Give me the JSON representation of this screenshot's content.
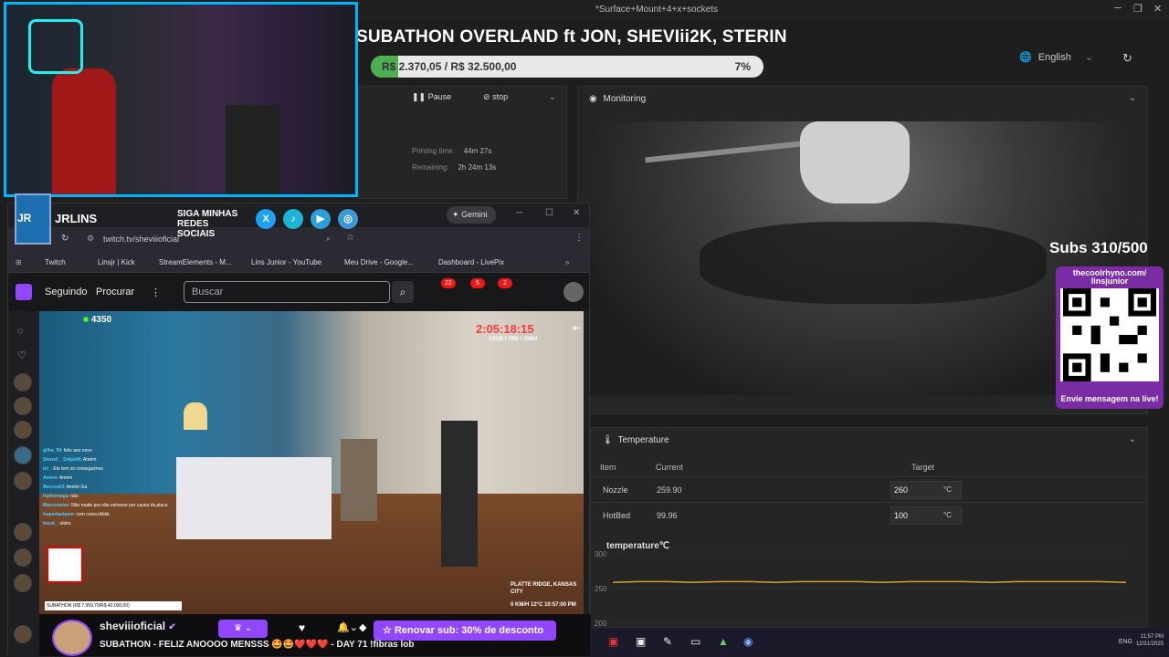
{
  "window": {
    "title": "*Surface+Mount+4+x+sockets"
  },
  "overlay": {
    "title": "SUBATHON OVERLAND ft JON, SHEVIii2K, STERIN",
    "goal_text": "R$ 2.370,05 / R$ 32.500,00",
    "goal_percent_label": "7%",
    "goal_progress": 0.07,
    "subs_counter": "Subs 310/500",
    "qr_url": "thecoolrhyno.com/ linsjunior",
    "qr_cta": "Envie mensagem na live!",
    "social_channel": "JRLINS",
    "social_siga": "SIGA MINHAS REDES SOCIAIS"
  },
  "printer": {
    "language": "English",
    "controls": {
      "pause_label": "Pause",
      "stop_label": "stop",
      "printing_time_label": "Printing time:",
      "printing_time_value": "44m 27s",
      "remaining_label": "Remaining:",
      "remaining_value": "2h 24m 13s"
    },
    "monitoring": {
      "title": "Monitoring"
    },
    "temperature": {
      "title": "Temperature",
      "col_item": "Item",
      "col_current": "Current",
      "col_target": "Target",
      "rows": [
        {
          "item": "Nozzle",
          "current": "259.90",
          "target": "260",
          "unit": "°C"
        },
        {
          "item": "HotBed",
          "current": "99.96",
          "target": "100",
          "unit": "°C"
        }
      ],
      "chart_title": "temperature℃"
    }
  },
  "chart_data": {
    "type": "line",
    "title": "temperature℃",
    "ylim": [
      200,
      300
    ],
    "yticks": [
      "300",
      "250",
      "200"
    ],
    "series": [
      {
        "color": "#d4a52a",
        "values": [
          259,
          260,
          260,
          259,
          260,
          260,
          259,
          260,
          260,
          260,
          259,
          260,
          260,
          260,
          259,
          260,
          260,
          260,
          260,
          259
        ]
      }
    ]
  },
  "browser": {
    "gemini_label": "Gemini",
    "url": "twitch.tv/sheviiioficial",
    "bookmarks": [
      "Twitch",
      "Linsjr | Kick",
      "StreamElements - M...",
      "Lins Junior - YouTube",
      "Meu Drive - Google...",
      "Dashboard - LivePix"
    ],
    "nav": {
      "following": "Seguindo",
      "browse": "Procurar",
      "search_placeholder": "Buscar"
    },
    "badges": [
      "22",
      "5",
      "2"
    ]
  },
  "stream": {
    "viewers": "4350",
    "timer": "2:05:18:15",
    "timer_sub": "1SUB / 7R$ = 2MIN",
    "location": "PLATTE RIDGE, KANSAS CITY",
    "speed": "0 KM/H  12°C  10:57:00 PM",
    "streamer": "sheviiioficial",
    "title": "SUBATHON - FELIZ ANOOOO MENSSS 🤩🤩❤️❤️❤️ - DAY 71 !fibras lob",
    "renovar": "Renovar sub: 30% de desconto",
    "mini_goal": "SUBATHON (R$ 7.959,70/R$ 40.000,00)",
    "chat": [
      {
        "user": "gilba_99",
        "msg": "feliz ano novo"
      },
      {
        "user": "Stone0__DolphiN",
        "msg": "Amém"
      },
      {
        "user": "lol_",
        "msg": "Ele tem só conseguimos"
      },
      {
        "user": "Amém",
        "msg": "Amém"
      },
      {
        "user": "Mercos03",
        "msg": "Amém Ga"
      },
      {
        "user": "Hydromega",
        "msg": "não"
      },
      {
        "user": "Marcoswise",
        "msg": "Não mude pra não estresse por causa da placa"
      },
      {
        "user": "trupertantasm",
        "msg": "com coisa kkkkk"
      },
      {
        "user": "tneck_",
        "msg": "oloko"
      }
    ]
  },
  "taskbar": {
    "lang": "ENG",
    "time": "11:57 PM",
    "date": "12/31/2025"
  }
}
